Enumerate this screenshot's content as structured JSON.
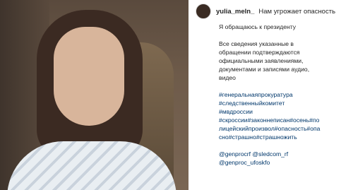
{
  "post": {
    "username": "yulia_meln_",
    "caption_title": "Нам угрожает опасность",
    "paragraph1": "Я обращаюсь к президенту",
    "paragraph2": "Все сведения указанные в\nобращении подтверждаются\nофициальными заявлениями,\nдокументами и записями аудио,\nвидео",
    "hashtag_lines": [
      "#генеральнаяпрокуратура",
      "#следственныйкомитет",
      "#мвдроссии",
      "#скроссии#законнеписан#осень#по",
      "лицейскийпроизвол#опасность#опа",
      "сно#страшно#страшножить"
    ],
    "mention_lines": [
      "@genprocrf @sledcom_rf",
      "@genproc_ufoskfo"
    ]
  },
  "video": {
    "volume_icon": "speaker-icon"
  }
}
